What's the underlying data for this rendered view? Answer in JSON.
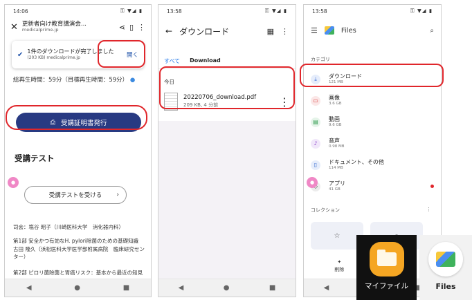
{
  "phone1": {
    "status_time": "14:06",
    "status_icons": "⚿ ▼◢ ▮",
    "title": "更新者向け教育講演会...",
    "domain": "medicalprime.jp",
    "banner_title": "1件のダウンロードが完了しました",
    "banner_sub": "(203 KB) medicalprime.jp",
    "banner_open": "開く",
    "play_time": "総再生時間：59分（目標再生時間：59分）",
    "cert_button": "受講証明書発行",
    "section_title": "受講テスト",
    "test_button": "受講テストを受ける",
    "chair": "司会：塩谷 昭子（川崎医科大学　消化器内科）",
    "part1": "第1部 安全かつ有効なH. pylori除菌のための基礎知識　古田 隆久（浜松医科大学医学部附属病院　臨床研究センター）",
    "part2": "第2部 ピロリ菌除菌と胃癌リスク：基本から最近の知見まで"
  },
  "phone2": {
    "status_time": "13:58",
    "status_icons": "⚿ ▼◢ ▮",
    "title": "ダウンロード",
    "tab_all": "すべて",
    "tab_download": "Download",
    "section_today": "今日",
    "file_name": "20220706_download.pdf",
    "file_meta": "209 KB, 4 分前"
  },
  "phone3": {
    "status_time": "13:58",
    "status_icons": "⚿ ▼◢ ▮",
    "title": "Files",
    "category_label": "カテゴリ",
    "categories": [
      {
        "name": "ダウンロード",
        "size": "121 MB",
        "color": "#3d6fd6",
        "bg": "#e6edfb",
        "icon": "⤓"
      },
      {
        "name": "画像",
        "size": "3.6 GB",
        "color": "#d83b3b",
        "bg": "#fbe7e7",
        "icon": "▭"
      },
      {
        "name": "動画",
        "size": "9.6 GB",
        "color": "#2e9a4d",
        "bg": "#e5f4e9",
        "icon": "▤"
      },
      {
        "name": "音声",
        "size": "0.98 MB",
        "color": "#8a3fc9",
        "bg": "#f1e7fa",
        "icon": "♪"
      },
      {
        "name": "ドキュメント、その他",
        "size": "114 MB",
        "color": "#3a6fd0",
        "bg": "#e6edfb",
        "icon": "▯"
      },
      {
        "name": "アプリ",
        "size": "41 GB",
        "color": "#444444",
        "bg": "#ececec",
        "icon": "◇"
      }
    ],
    "collection_label": "コレクション",
    "bottom_delete": "削除",
    "bottom_share": "有"
  },
  "tiles": {
    "myfile_label": "マイファイル",
    "files_label": "Files"
  }
}
